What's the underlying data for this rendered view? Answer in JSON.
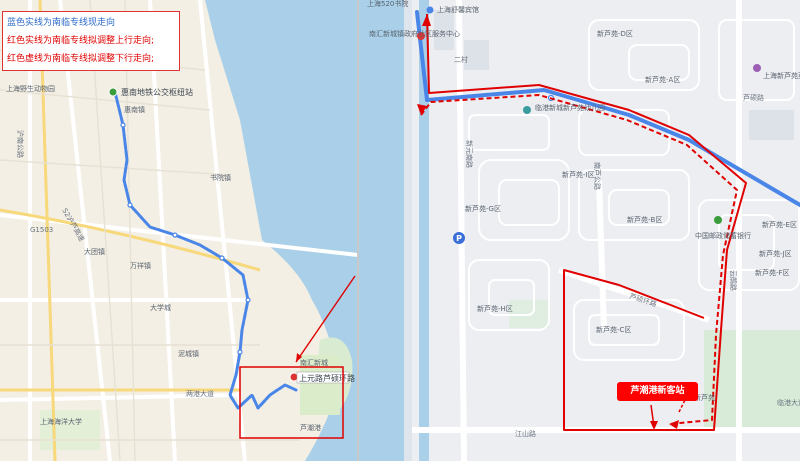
{
  "legend": {
    "blue_line": "蓝色实线为南临专线现走向",
    "red_solid": "红色实线为南临专线拟调整上行走向;",
    "red_dashed": "红色虚线为南临专线拟调整下行走向;"
  },
  "left_map": {
    "start_stop": "惠南地铁公交枢纽站",
    "end_stop": "上元路芦硕环路",
    "places": [
      "上海野生动物园",
      "惠南镇",
      "大团镇",
      "南汇新城",
      "万祥镇",
      "书院镇",
      "泥城镇",
      "芦潮港",
      "大学城",
      "上海海洋大学"
    ],
    "roads": [
      "沪南公路",
      "两港大道",
      "S2沪芦高速",
      "G1503"
    ]
  },
  "right_map": {
    "places": [
      "上海520书院",
      "上海舒馨宾馆",
      "南汇新城镇政府社区服务中心",
      "临港新城新芦苑幼儿园",
      "新芦苑-D区",
      "新芦苑-A区",
      "新芦苑-B区",
      "新芦苑-C区",
      "新芦苑-G区",
      "新芦苑-H区",
      "新芦苑-I区",
      "新芦苑-F区",
      "新芦苑-E区",
      "新芦苑-J区",
      "上海新芦苑菜市场",
      "中国邮政储蓄银行",
      "新芦苑"
    ],
    "roads": [
      "芦硕环路",
      "江山路",
      "临港大道",
      "南芦公路",
      "新元南路",
      "云鹃路",
      "芦硕路",
      "二村"
    ],
    "terminus_label": "芦潮港新客站",
    "parking_symbol": "P"
  },
  "colors": {
    "blue_route": "#4a86e8",
    "red_route": "#e00000",
    "water": "#a9d0e8",
    "road": "#ffffff",
    "land_left": "#f2efe6",
    "land_right": "#eceef2"
  }
}
